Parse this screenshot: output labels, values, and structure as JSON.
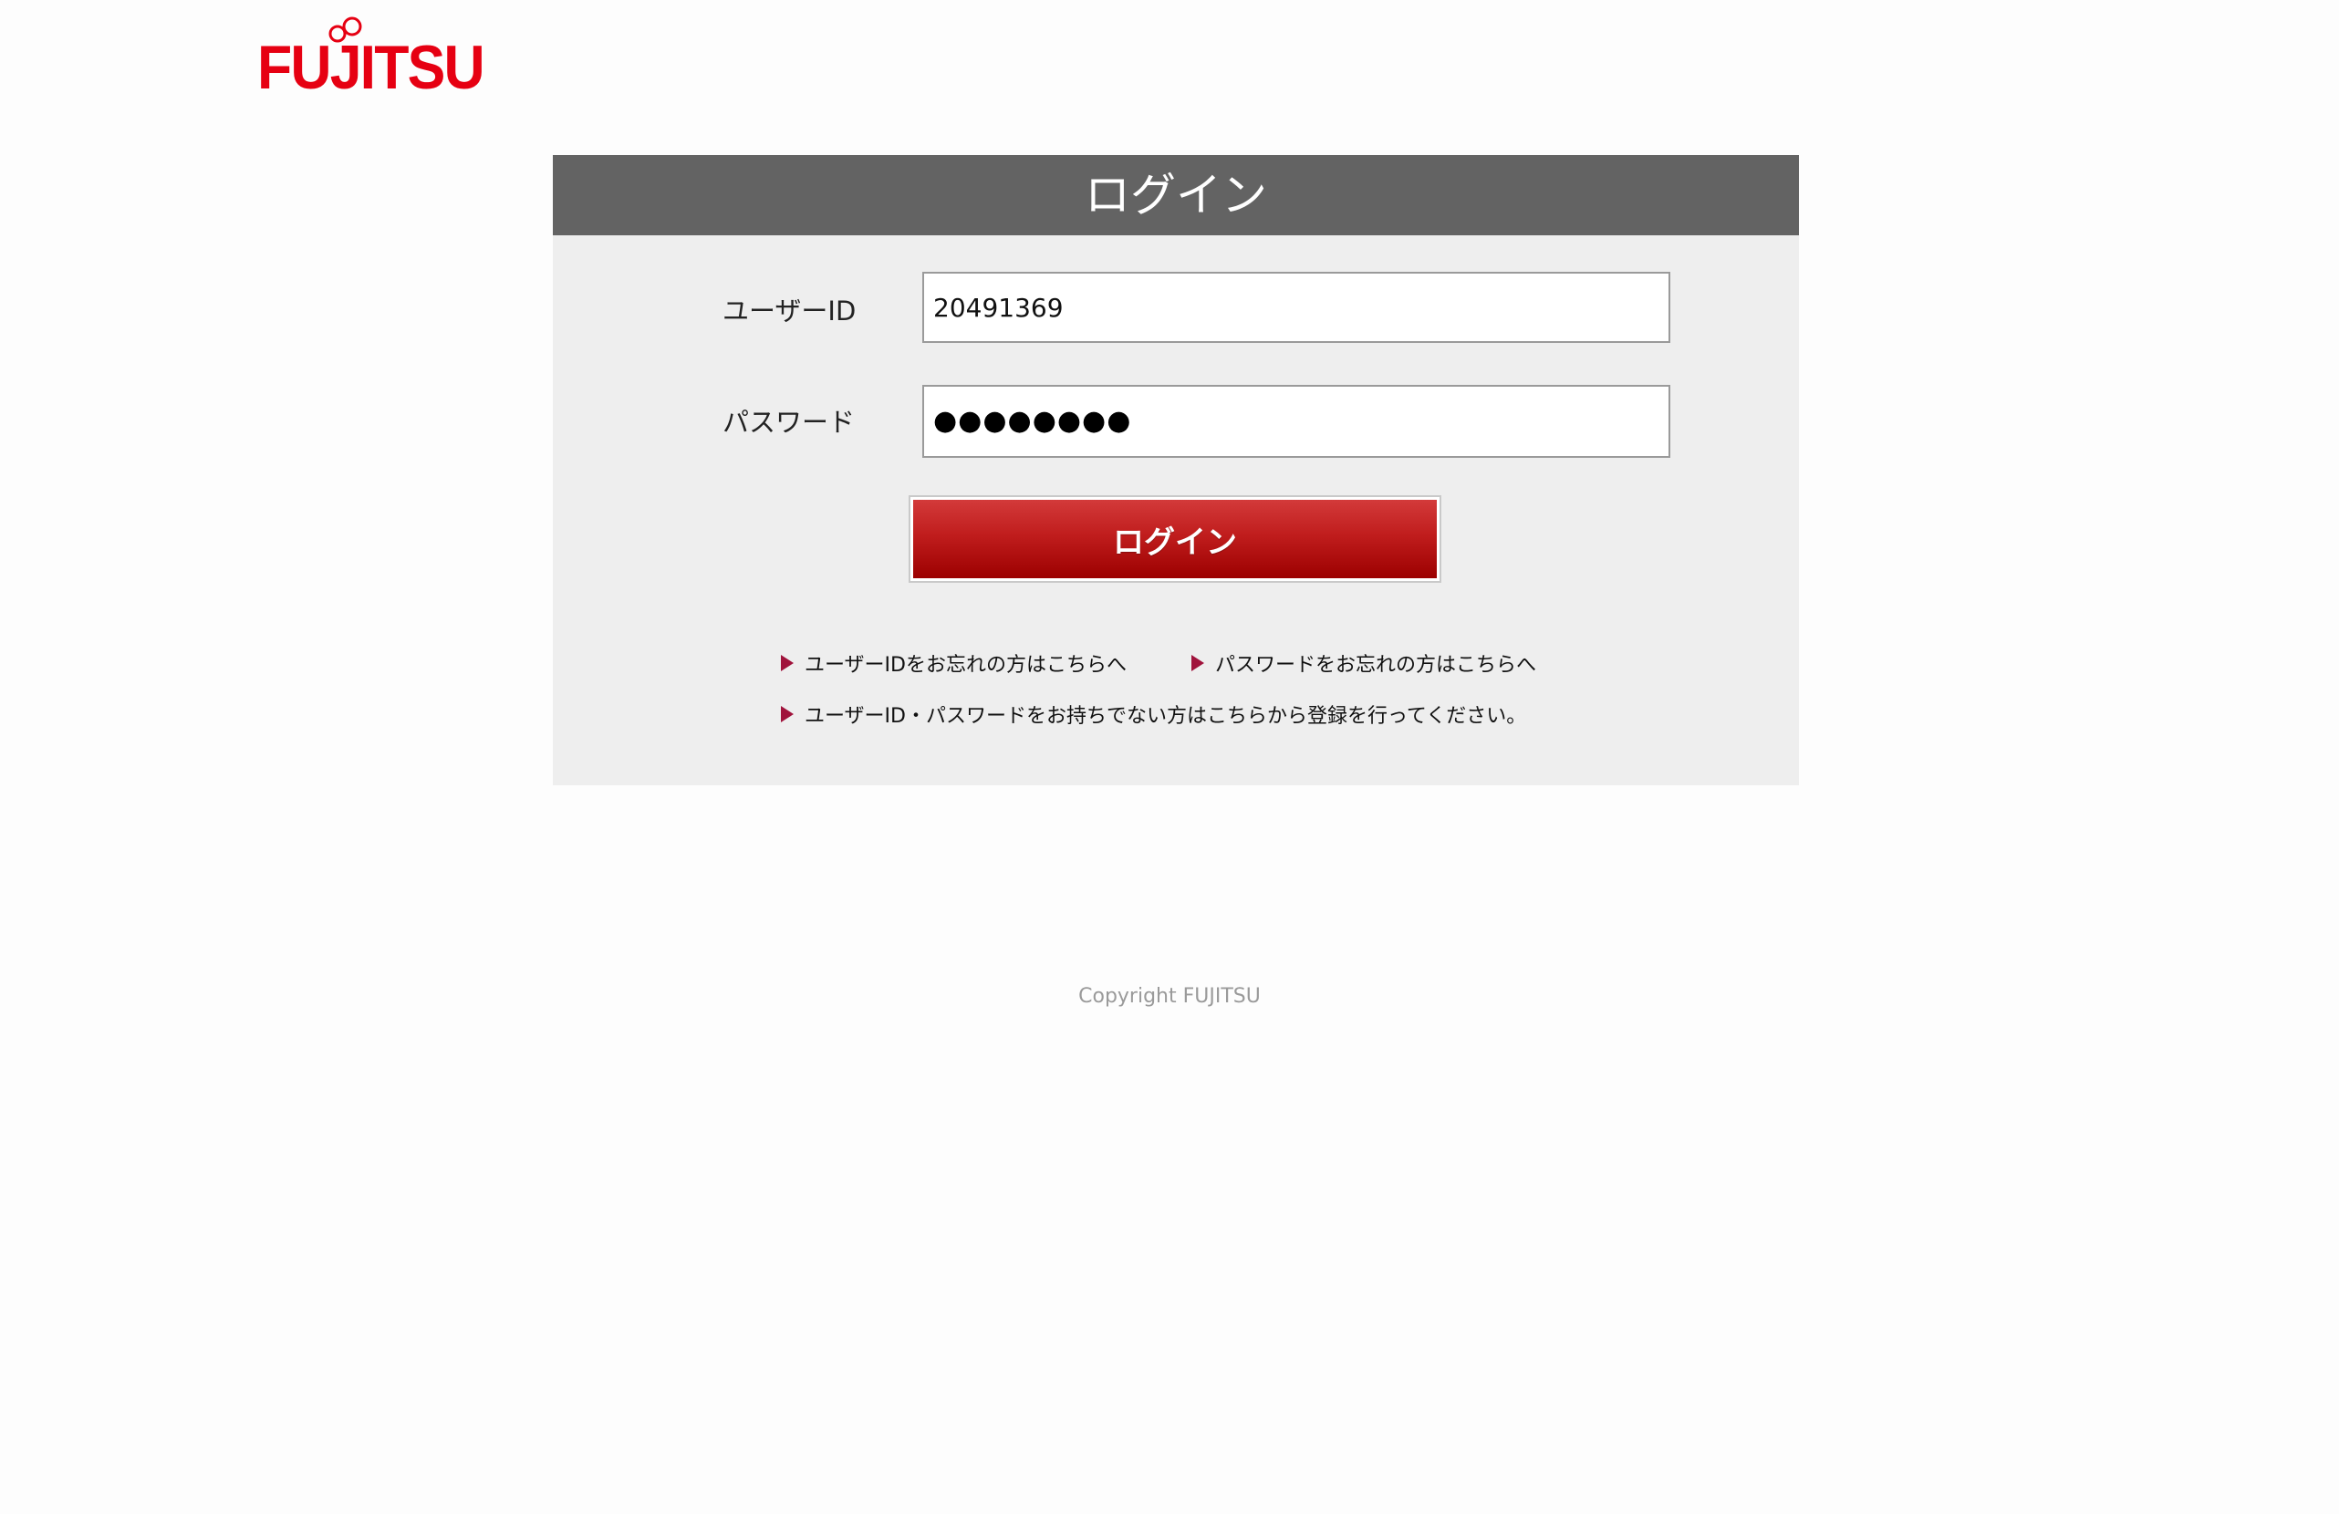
{
  "brand": {
    "name": "FUJITSU",
    "color": "#e60012"
  },
  "panel": {
    "title": "ログイン"
  },
  "form": {
    "user_id_label": "ユーザーID",
    "user_id_value": "20491369",
    "password_label": "パスワード",
    "password_masked": "●●●●●●●●",
    "login_button": "ログイン"
  },
  "links": {
    "forgot_user_id": "ユーザーIDをお忘れの方はこちらへ",
    "forgot_password": "パスワードをお忘れの方はこちらへ",
    "register": "ユーザーID・パスワードをお持ちでない方はこちらから登録を行ってください。"
  },
  "footer": {
    "copyright": "Copyright FUJITSU"
  },
  "colors": {
    "header_bg": "#636363",
    "panel_bg": "#eeeeee",
    "button_red": "#c01d1d",
    "link_arrow": "#a0133c"
  }
}
